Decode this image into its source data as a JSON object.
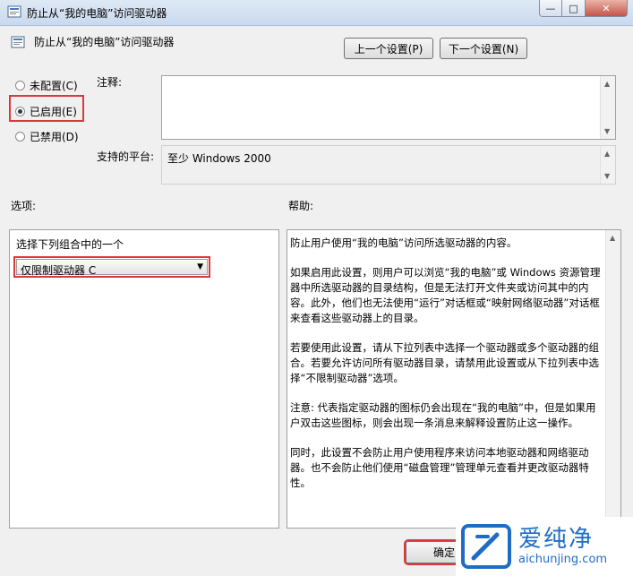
{
  "window": {
    "title": "防止从“我的电脑”访问驱动器",
    "min_glyph": "—",
    "max_glyph": "□",
    "close_glyph": "✕"
  },
  "header": {
    "policy_title": "防止从“我的电脑”访问驱动器",
    "prev_button": "上一个设置(P)",
    "next_button": "下一个设置(N)"
  },
  "state": {
    "options": [
      {
        "label": "未配置(C)",
        "checked": false
      },
      {
        "label": "已启用(E)",
        "checked": true
      },
      {
        "label": "已禁用(D)",
        "checked": false
      }
    ]
  },
  "comment": {
    "label": "注释:",
    "value": ""
  },
  "platform": {
    "label": "支持的平台:",
    "value": "至少 Windows 2000"
  },
  "options_section": {
    "label": "选项:",
    "combo_caption": "选择下列组合中的一个",
    "combo_value": "仅限制驱动器 C"
  },
  "help_section": {
    "label": "帮助:",
    "paragraphs": [
      "防止用户使用“我的电脑”访问所选驱动器的内容。",
      "如果启用此设置，则用户可以浏览“我的电脑”或 Windows 资源管理器中所选驱动器的目录结构，但是无法打开文件夹或访问其中的内容。此外，他们也无法使用“运行”对话框或“映射网络驱动器”对话框来查看这些驱动器上的目录。",
      "若要使用此设置，请从下拉列表中选择一个驱动器或多个驱动器的组合。若要允许访问所有驱动器目录，请禁用此设置或从下拉列表中选择“不限制驱动器”选项。",
      "注意: 代表指定驱动器的图标仍会出现在“我的电脑”中，但是如果用户双击这些图标，则会出现一条消息来解释设置防止这一操作。",
      "同时，此设置不会防止用户使用程序来访问本地驱动器和网络驱动器。也不会防止他们使用“磁盘管理”管理单元查看并更改驱动器特性。"
    ]
  },
  "footer": {
    "ok_button": "确定"
  },
  "watermark": {
    "name": "爱纯净",
    "url": "aichunjing.com"
  },
  "colors": {
    "highlight": "#d93a3a",
    "watermark_blue": "#1f6cc4"
  }
}
